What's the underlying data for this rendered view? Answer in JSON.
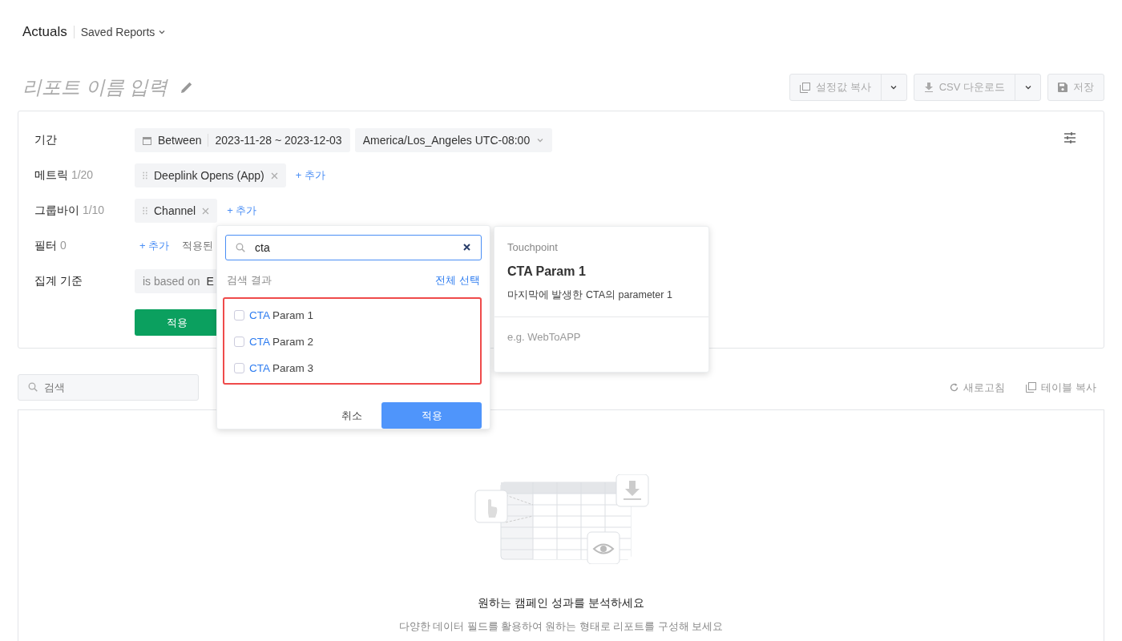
{
  "header": {
    "title": "Actuals",
    "saved_reports": "Saved Reports"
  },
  "report_name": {
    "placeholder": "리포트 이름 입력"
  },
  "toolbar": [
    {
      "kind": "split",
      "label": "설정값 복사"
    },
    {
      "kind": "split",
      "label": "CSV 다운로드"
    },
    {
      "kind": "plain",
      "label": "저장"
    }
  ],
  "config": {
    "period": {
      "label": "기간",
      "mode": "Between",
      "range": "2023-11-28 ~ 2023-12-03",
      "timezone": "America/Los_Angeles UTC-08:00"
    },
    "metrics": {
      "label": "메트릭",
      "count": "1/20",
      "chips": [
        "Deeplink Opens (App)"
      ],
      "add": "+ 추가"
    },
    "group_by": {
      "label": "그룹바이",
      "count": "1/10",
      "chips": [
        "Channel"
      ],
      "add": "+ 추가"
    },
    "filter": {
      "label": "필터",
      "count": "0",
      "add": "+ 추가",
      "note": "적용된"
    },
    "aggregation": {
      "label": "집계 기준",
      "prefix": "is based on",
      "value": "E"
    },
    "apply": "적용"
  },
  "table_toolbar": {
    "search": {
      "placeholder": "검색"
    },
    "actions": [
      {
        "label": "새로고침"
      },
      {
        "label": "테이블 복사"
      }
    ]
  },
  "empty_state": {
    "title": "원하는 캠페인 성과를 분석하세요",
    "subtitle": "다양한 데이터 필드를 활용하여 원하는 형태로 리포트를 구성해 보세요"
  },
  "dropdown": {
    "search": {
      "value": "cta"
    },
    "results_label": "검색 결과",
    "select_all": "전체 선택",
    "items": [
      {
        "match": "CTA",
        "label": "Param 1",
        "checked": false
      },
      {
        "match": "CTA",
        "label": "Param 2",
        "checked": false
      },
      {
        "match": "CTA",
        "label": "Param 3",
        "checked": false
      }
    ],
    "cancel": "취소",
    "apply": "적용"
  },
  "detail": {
    "category": "Touchpoint",
    "title": "CTA Param 1",
    "description": "마지막에 발생한 CTA의 parameter 1",
    "example": "e.g. WebToAPP"
  }
}
